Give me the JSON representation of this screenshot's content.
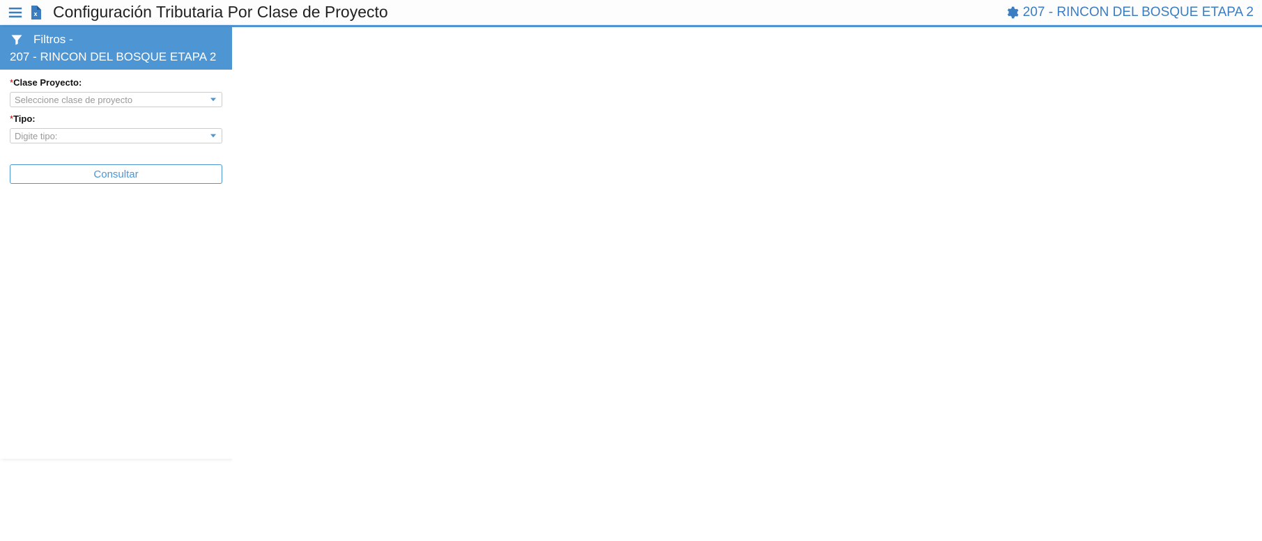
{
  "header": {
    "title": "Configuración Tributaria Por Clase de Proyecto",
    "context_label": "207 - RINCON DEL BOSQUE ETAPA 2"
  },
  "sidebar": {
    "title_prefix": "Filtros - ",
    "title_context": "207 - RINCON DEL BOSQUE ETAPA 2",
    "form": {
      "clase_proyecto": {
        "label": "Clase Proyecto:",
        "placeholder": "Seleccione clase de proyecto",
        "value": ""
      },
      "tipo": {
        "label": "Tipo:",
        "placeholder": "Digite tipo:",
        "value": ""
      },
      "submit_label": "Consultar"
    }
  }
}
